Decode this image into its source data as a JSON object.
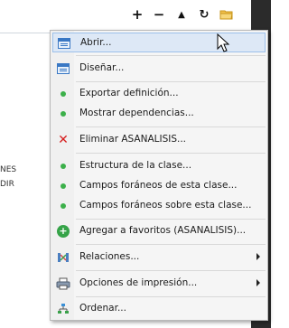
{
  "toolbar": {
    "plus": "+",
    "minus": "−",
    "up": "▲",
    "refresh": "↻"
  },
  "background": {
    "rows": [
      "NES",
      "DIR"
    ]
  },
  "menu": {
    "items": [
      {
        "label": "Abrir...",
        "icon": "window-icon"
      },
      {
        "label": "Diseñar...",
        "icon": "window-icon"
      },
      {
        "label": "Exportar definición...",
        "icon": "green-dot-icon"
      },
      {
        "label": "Mostrar dependencias...",
        "icon": "green-dot-icon"
      },
      {
        "label": "Eliminar ASANALISIS...",
        "icon": "delete-x-icon"
      },
      {
        "label": "Estructura de la clase...",
        "icon": "green-dot-icon"
      },
      {
        "label": "Campos foráneos de esta clase...",
        "icon": "green-dot-icon"
      },
      {
        "label": "Campos foráneos sobre esta clase...",
        "icon": "green-dot-icon"
      },
      {
        "label": "Agregar a favoritos (ASANALISIS)...",
        "icon": "add-favorite-icon"
      },
      {
        "label": "Relaciones...",
        "icon": "relations-icon"
      },
      {
        "label": "Opciones de impresión...",
        "icon": "printer-icon"
      },
      {
        "label": "Ordenar...",
        "icon": "tree-icon"
      }
    ]
  },
  "colors": {
    "highlight": "#dde8f6",
    "highlight_border": "#9cc0ea",
    "green": "#3cb04a",
    "delete_red": "#d61f1f"
  }
}
